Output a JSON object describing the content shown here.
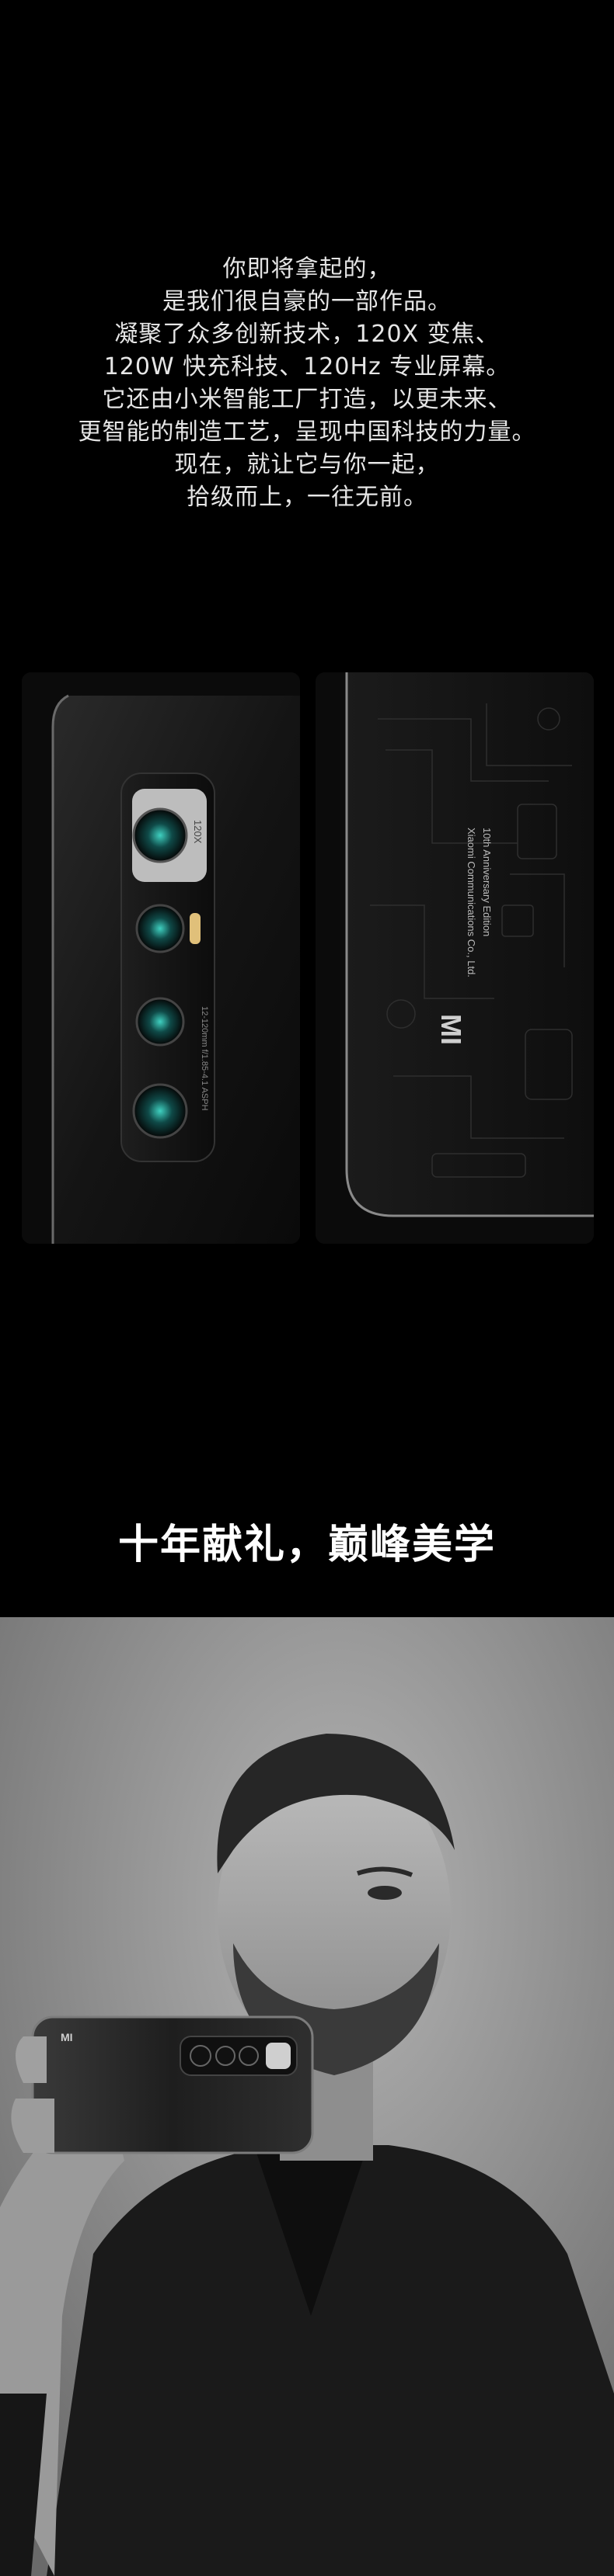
{
  "intro": {
    "lines": [
      "你即将拿起的，",
      "是我们很自豪的一部作品。",
      "凝聚了众多创新技术，120X 变焦、",
      "120W 快充科技、120Hz 专业屏幕。",
      "它还由小米智能工厂打造，以更未来、",
      "更智能的制造工艺，呈现中国科技的力量。",
      "现在，就让它与你一起，",
      "拾级而上，一往无前。"
    ]
  },
  "gallery": {
    "camera_module": {
      "zoom_label": "120X",
      "lens_spec": "12-120mm f/1.85-4.1 ASPH"
    },
    "back_print": {
      "brand_logo": "MI",
      "maker": "Xiaomi Communications Co., Ltd.",
      "edition": "10th Anniversary Edition"
    }
  },
  "headline": "十年献礼，巅峰美学"
}
